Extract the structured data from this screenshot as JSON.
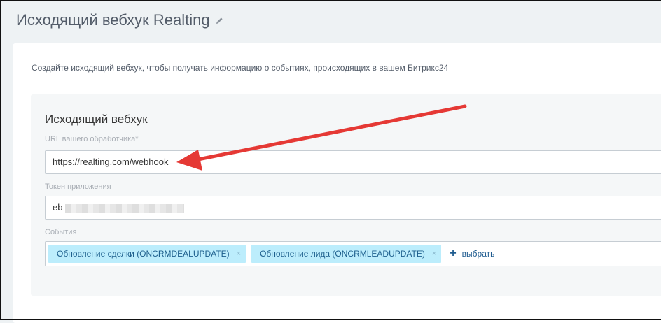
{
  "page": {
    "title": "Исходящий вебхук Realting"
  },
  "description": "Создайте исходящий вебхук, чтобы получать информацию о событиях, происходящих в вашем Битрикс24",
  "form": {
    "section_title": "Исходящий вебхук",
    "url_label": "URL вашего обработчика*",
    "url_value": "https://realting.com/webhook",
    "token_label": "Токен приложения",
    "token_value_visible": "eb",
    "events_label": "События",
    "events": [
      {
        "label": "Обновление сделки (ONCRMDEALUPDATE)"
      },
      {
        "label": "Обновление лида (ONCRMLEADUPDATE)"
      }
    ],
    "remove_symbol": "×",
    "add_label": "выбрать",
    "add_symbol": "+"
  },
  "colors": {
    "annotation_arrow": "#e53935",
    "tag_background": "#bcedfc",
    "tag_text": "#1d5f8d"
  }
}
